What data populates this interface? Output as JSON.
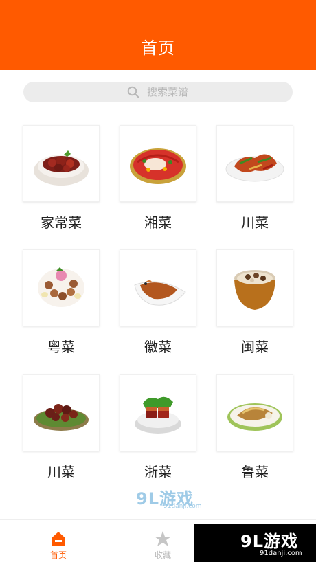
{
  "header": {
    "title": "首页",
    "background_color": "#ff5a00"
  },
  "search": {
    "placeholder": "搜索菜谱",
    "icon": "search-icon"
  },
  "categories": [
    {
      "label": "家常菜",
      "image": "braised-pork-bowl"
    },
    {
      "label": "湘菜",
      "image": "spicy-fish-platter"
    },
    {
      "label": "川菜",
      "image": "stir-fried-peppers"
    },
    {
      "label": "粤菜",
      "image": "dim-sum-plate"
    },
    {
      "label": "徽菜",
      "image": "braised-fish"
    },
    {
      "label": "闽菜",
      "image": "soup-pot"
    },
    {
      "label": "川菜",
      "image": "spicy-meat-pieces"
    },
    {
      "label": "浙菜",
      "image": "dongpo-pork"
    },
    {
      "label": "鲁菜",
      "image": "braised-fish-sauce"
    }
  ],
  "tabbar": {
    "home_label": "首页",
    "favorites_label": "收藏",
    "active_color": "#ff5a00",
    "inactive_color": "#b8b8b8"
  },
  "watermark": {
    "brand": "9L游戏",
    "url": "91danji.com"
  }
}
